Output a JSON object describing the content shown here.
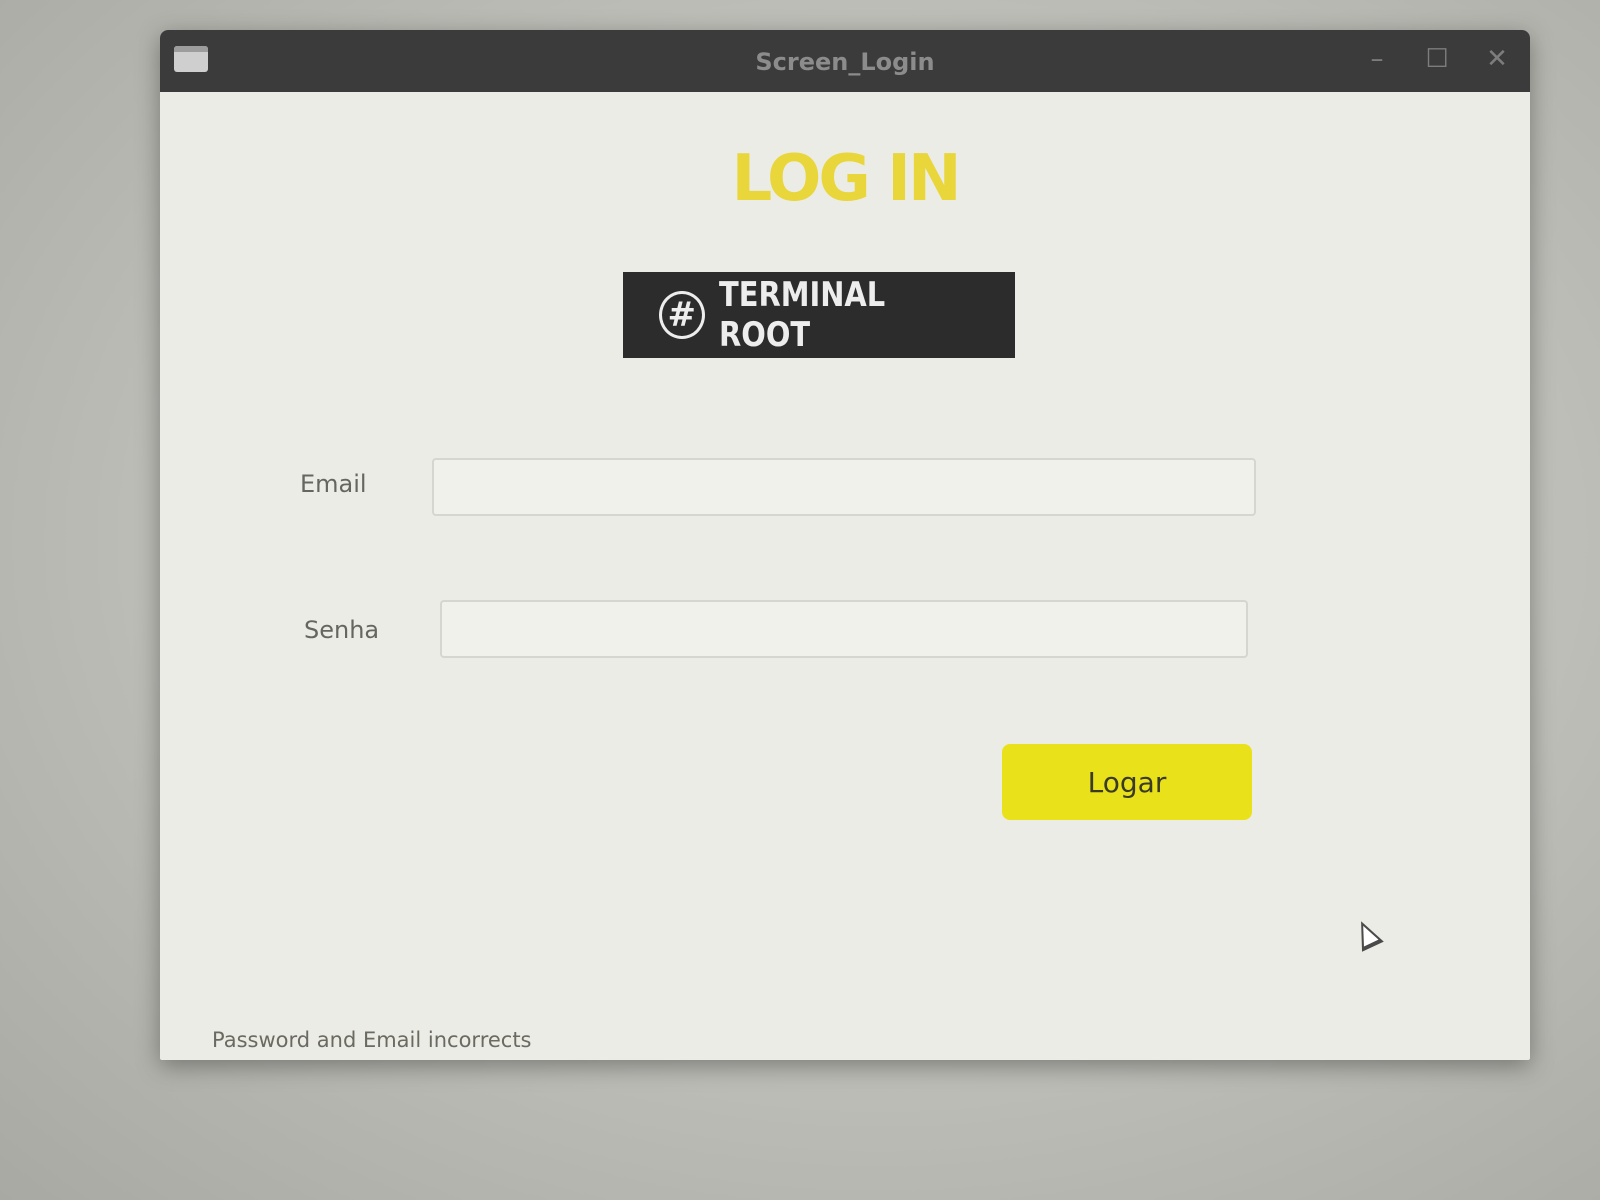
{
  "window": {
    "title": "Screen_Login",
    "controls": {
      "minimize": "–",
      "maximize": "☐",
      "close": "✕"
    }
  },
  "page": {
    "heading": "LOG IN",
    "logo": {
      "symbol": "#",
      "text": "TERMINAL ROOT"
    }
  },
  "form": {
    "email_label": "Email",
    "email_value": "",
    "password_label": "Senha",
    "password_value": "",
    "submit_label": "Logar"
  },
  "status": {
    "message": "Password and Email incorrects"
  },
  "colors": {
    "accent_yellow": "#e9e21a",
    "heading_yellow": "#e8d63a",
    "logo_background": "#2c2c2c",
    "titlebar": "#3b3b3b"
  },
  "icons": {
    "app": "window-icon",
    "logo": "hash-icon",
    "cursor": "mouse-pointer-icon"
  }
}
